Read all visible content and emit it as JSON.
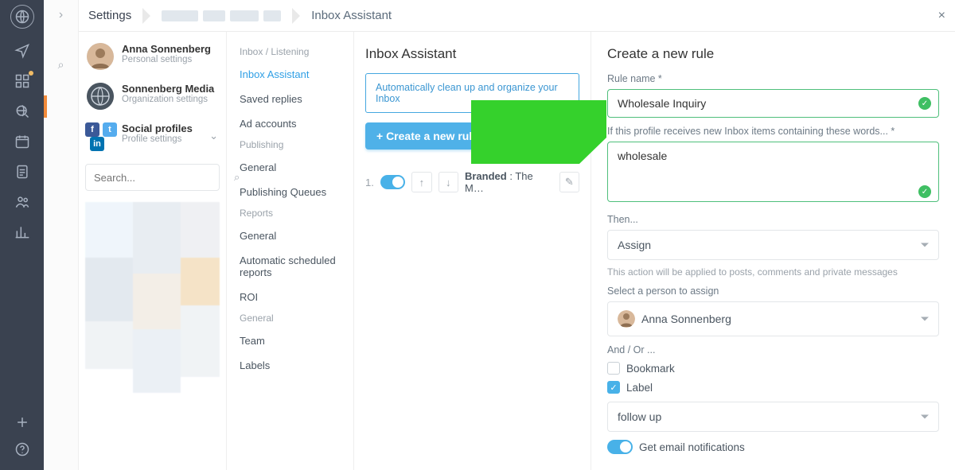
{
  "breadcrumb": {
    "settings": "Settings",
    "current": "Inbox Assistant"
  },
  "close_label": "×",
  "accounts": {
    "user": {
      "name": "Anna Sonnenberg",
      "sub": "Personal settings"
    },
    "org": {
      "name": "Sonnenberg Media",
      "sub": "Organization settings"
    },
    "social": {
      "name": "Social profiles",
      "sub": "Profile settings"
    }
  },
  "search": {
    "placeholder": "Search..."
  },
  "nav": {
    "group1": "Inbox / Listening",
    "items1": [
      "Inbox Assistant",
      "Saved replies",
      "Ad accounts"
    ],
    "group2": "Publishing",
    "items2": [
      "General",
      "Publishing Queues"
    ],
    "group3": "Reports",
    "items3": [
      "General",
      "Automatic scheduled reports",
      "ROI"
    ],
    "group4": "General",
    "items4": [
      "Team",
      "Labels"
    ]
  },
  "center": {
    "title": "Inbox Assistant",
    "banner": "Automatically clean up and organize your Inbox",
    "create_btn": "+ Create a new rule",
    "rule_index": "1.",
    "rule_name": "Branded",
    "rule_rest": " : The M…"
  },
  "form": {
    "title": "Create a new rule",
    "rule_name_label": "Rule name *",
    "rule_name_value": "Wholesale Inquiry",
    "keywords_label": "If this profile receives new Inbox items containing these words... *",
    "keywords_value": "wholesale",
    "then_label": "Then...",
    "action_selected": "Assign",
    "action_hint": "This action will be applied to posts, comments and private messages",
    "person_label": "Select a person to assign",
    "person_selected": "Anna Sonnenberg",
    "and_or_label": "And / Or ...",
    "bookmark_label": "Bookmark",
    "label_checkbox_label": "Label",
    "label_selected": "follow up",
    "email_notif_label": "Get email notifications"
  },
  "icons": {
    "rail": [
      "webglobe",
      "send",
      "dashboard",
      "globe-search",
      "calendar",
      "clipboard",
      "people",
      "chart",
      "plus",
      "help"
    ],
    "chevron_right": "›",
    "magnifier": "⌕",
    "search_icon": "⌕",
    "pencil": "✎",
    "arrow_up": "↑",
    "arrow_down": "↓",
    "check": "✓",
    "chevron_down": "⌄"
  },
  "colors": {
    "accent": "#48b1e8",
    "ok": "#3fbf63",
    "arrow": "#35d12c"
  }
}
